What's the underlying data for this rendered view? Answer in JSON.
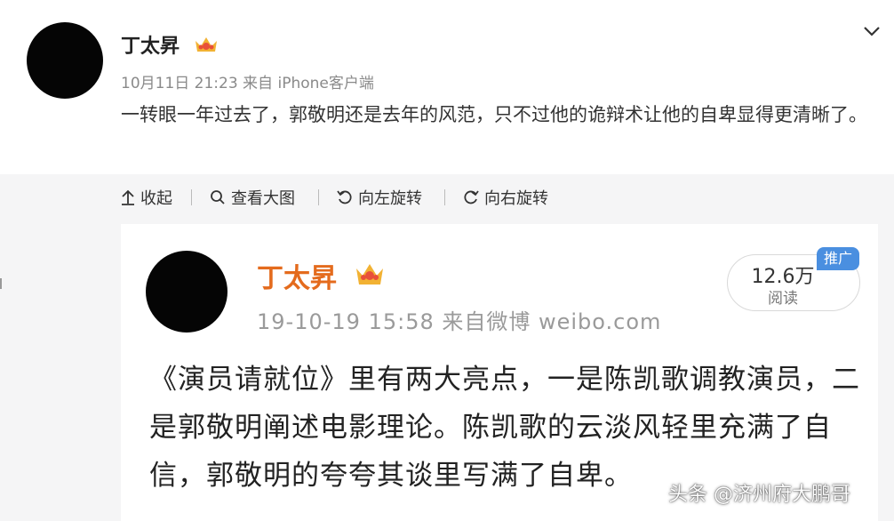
{
  "post": {
    "author": "丁太昇",
    "meta": "10月11日 21:23 来自 iPhone客户端",
    "text": "一转眼一年过去了，郭敬明还是去年的风范，只不过他的诡辩术让他的自卑显得更清晰了。"
  },
  "toolbar": {
    "collapse": "收起",
    "view_large": "查看大图",
    "rotate_left": "向左旋转",
    "rotate_right": "向右旋转"
  },
  "embedded": {
    "author": "丁太昇",
    "meta": "19-10-19 15:58 来自微博 weibo.com",
    "reads_count": "12.6万",
    "reads_label": "阅读",
    "ad_badge": "推广",
    "text": "《演员请就位》里有两大亮点，一是陈凯歌调教演员，二是郭敬明阐述电影理论。陈凯歌的云淡风轻里充满了自信，郭敬明的夸夸其谈里写满了自卑。"
  },
  "watermark": "头条 @济州府大鹏哥",
  "colors": {
    "embedded_author": "#e46b1d",
    "toolbar_bg": "#f5f5f6",
    "ad_badge": "#4a8fe0"
  }
}
